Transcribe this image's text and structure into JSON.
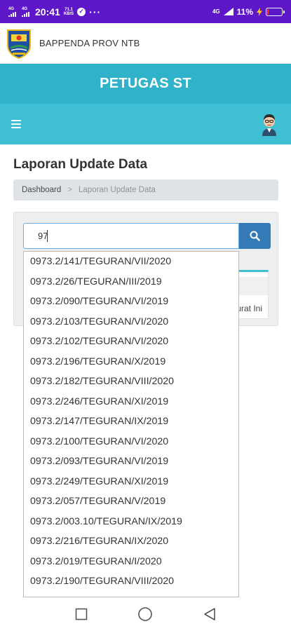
{
  "status_bar": {
    "signal_1": "4G",
    "signal_2": "4G",
    "time": "20:41",
    "net_speed_value": "71.1",
    "net_speed_unit": "KB/S",
    "more": "···",
    "right_network": "4G",
    "battery_percent": "11%",
    "battery_level": 0.11,
    "battery_color": "#ff3b30"
  },
  "brand": {
    "name": "BAPPENDA PROV NTB"
  },
  "header": {
    "title": "PETUGAS ST",
    "title_bg": "#30b3ca",
    "nav_bg": "#3ebfd4"
  },
  "page": {
    "title": "Laporan Update Data",
    "breadcrumb": {
      "home": "Dashboard",
      "separator": ">",
      "current": "Laporan Update Data"
    }
  },
  "search": {
    "value": "97",
    "button_color": "#337ab7"
  },
  "panel_peek_text": "urat Ini",
  "suggestions": [
    "0973.2/141/TEGURAN/VII/2020",
    "0973.2/26/TEGURAN/III/2019",
    "0973.2/090/TEGURAN/VI/2019",
    "0973.2/103/TEGURAN/VI/2020",
    "0973.2/102/TEGURAN/VI/2020",
    "0973.2/196/TEGURAN/X/2019",
    "0973.2/182/TEGURAN/VIII/2020",
    "0973.2/246/TEGURAN/XI/2019",
    "0973.2/147/TEGURAN/IX/2019",
    "0973.2/100/TEGURAN/VI/2020",
    "0973.2/093/TEGURAN/VI/2019",
    "0973.2/249/TEGURAN/XI/2019",
    "0973.2/057/TEGURAN/V/2019",
    "0973.2/003.10/TEGURAN/IX/2019",
    "0973.2/216/TEGURAN/IX/2020",
    "0973.2/019/TEGURAN/I/2020",
    "0973.2/190/TEGURAN/VIII/2020"
  ],
  "icons": {
    "menu": "hamburger-icon",
    "avatar": "user-avatar-icon",
    "search": "search-icon",
    "recents": "square-icon",
    "home": "circle-icon",
    "back": "triangle-back-icon"
  }
}
